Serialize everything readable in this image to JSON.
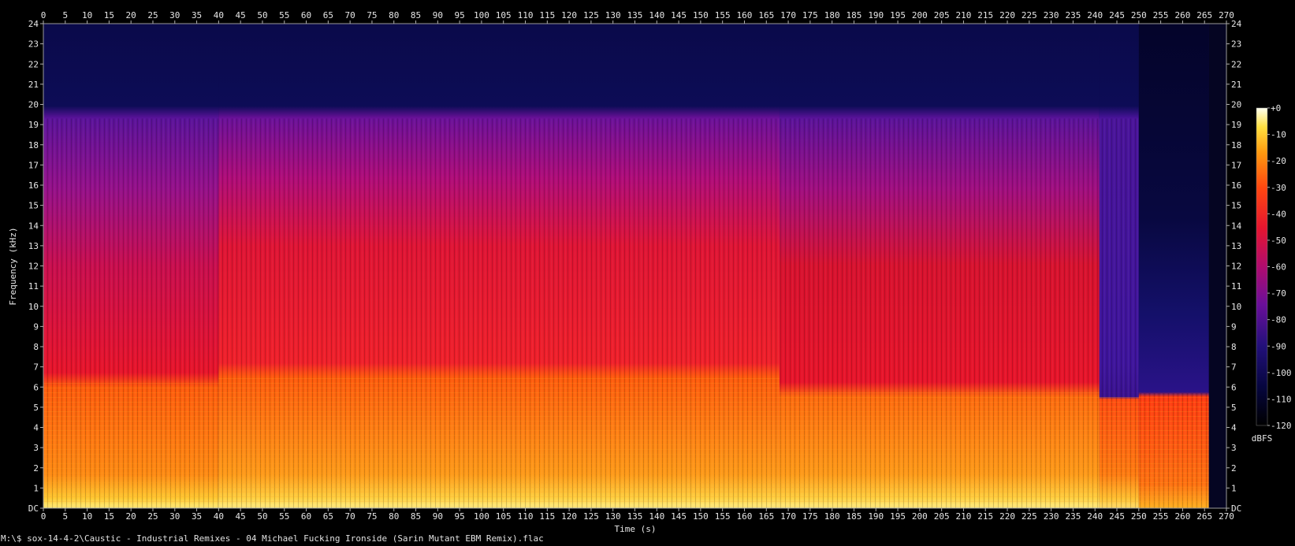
{
  "chart_data": {
    "type": "heatmap",
    "title": "",
    "xlabel": "Time (s)",
    "ylabel": "Frequency (kHz)",
    "xlim": [
      0,
      270
    ],
    "ylim": [
      0,
      24
    ],
    "x_ticks": [
      "0",
      "5",
      "10",
      "15",
      "20",
      "25",
      "30",
      "35",
      "40",
      "45",
      "50",
      "55",
      "60",
      "65",
      "70",
      "75",
      "80",
      "85",
      "90",
      "95",
      "100",
      "105",
      "110",
      "115",
      "120",
      "125",
      "130",
      "135",
      "140",
      "145",
      "150",
      "155",
      "160",
      "165",
      "170",
      "175",
      "180",
      "185",
      "190",
      "195",
      "200",
      "205",
      "210",
      "215",
      "220",
      "225",
      "230",
      "235",
      "240",
      "245",
      "250",
      "255",
      "260",
      "265",
      "270"
    ],
    "y_ticks": [
      "DC",
      "1",
      "2",
      "3",
      "4",
      "5",
      "6",
      "7",
      "8",
      "9",
      "10",
      "11",
      "12",
      "13",
      "14",
      "15",
      "16",
      "17",
      "18",
      "19",
      "20",
      "21",
      "22",
      "23",
      "24"
    ],
    "colorbar": {
      "label": "dBFS",
      "ticks": [
        "+0",
        "-10",
        "-20",
        "-30",
        "-40",
        "-50",
        "-60",
        "-70",
        "-80",
        "-90",
        "-100",
        "-110",
        "-120"
      ],
      "range": [
        -120,
        0
      ]
    },
    "segments": [
      {
        "start": 0,
        "end": 40,
        "cutoff_khz": 19.3,
        "bright_top_khz": 6.3
      },
      {
        "start": 40,
        "end": 168,
        "cutoff_khz": 19.3,
        "bright_top_khz": 6.5
      },
      {
        "start": 168,
        "end": 241,
        "cutoff_khz": 19.3,
        "bright_top_khz": 5.8
      },
      {
        "start": 241,
        "end": 250,
        "cutoff_khz": 19.3,
        "bright_top_khz": 5.7
      },
      {
        "start": 250,
        "end": 266,
        "cutoff_khz": 5.7,
        "bright_top_khz": 5.5
      }
    ],
    "end_of_audio_s": 266
  },
  "caption": "M:\\$ sox-14-4-2\\Caustic - Industrial Remixes - 04 Michael Fucking Ironside (Sarin Mutant EBM Remix).flac"
}
